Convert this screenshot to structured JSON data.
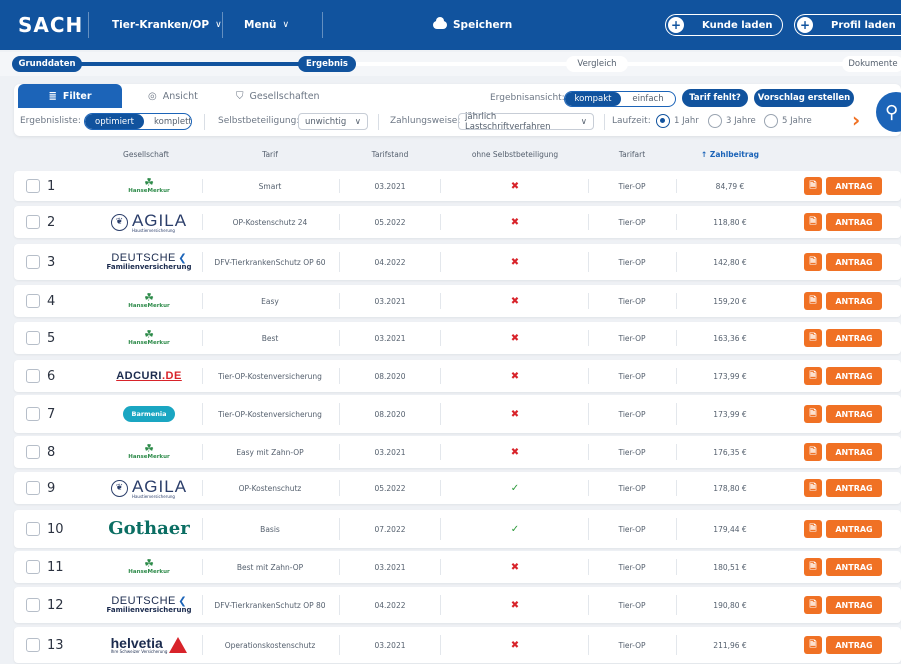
{
  "topbar": {
    "brand": "SACH",
    "product": "Tier-Kranken/OP",
    "menu": "Menü",
    "save": "Speichern",
    "load_customer": "Kunde laden",
    "load_profile": "Profil laden"
  },
  "steps": [
    {
      "label": "Grunddaten",
      "active": true
    },
    {
      "label": "Ergebnis",
      "active": true
    },
    {
      "label": "Vergleich",
      "active": false
    },
    {
      "label": "Dokumente",
      "active": false
    }
  ],
  "filterbar": {
    "tabs": [
      {
        "label": "Filter",
        "icon": "sliders-icon",
        "active": true
      },
      {
        "label": "Ansicht",
        "icon": "eye-icon",
        "active": false
      },
      {
        "label": "Gesellschaften",
        "icon": "shield-check-icon",
        "active": false
      }
    ],
    "view_label": "Ergebnisansicht:",
    "view_options": [
      "kompakt",
      "einfach"
    ],
    "view_selected": "kompakt",
    "tarif_missing": "Tarif fehlt?",
    "suggestion": "Vorschlag erstellen",
    "resultlist_label": "Ergebnisliste:",
    "resultlist_options": [
      "optimiert",
      "komplett"
    ],
    "resultlist_selected": "optimiert",
    "deductible_label": "Selbstbeteiligung:",
    "deductible_value": "unwichtig",
    "payment_label": "Zahlungsweise:",
    "payment_value": "jährlich Lastschriftverfahren",
    "term_label": "Laufzeit:",
    "term_options": [
      "1 Jahr",
      "3 Jahre",
      "5 Jahre"
    ],
    "term_selected": "1 Jahr"
  },
  "table": {
    "headers": {
      "company": "Gesellschaft",
      "tariff": "Tarif",
      "tariff_date": "Tarifstand",
      "no_deductible": "ohne Selbstbeteiligung",
      "tariff_type": "Tarifart",
      "premium": "Zahlbeitrag"
    },
    "sort_column": "premium",
    "action_label": "ANTRAG",
    "rows": [
      {
        "no": "1",
        "logo": "hansemerkur",
        "tariff": "Smart",
        "date": "03.2021",
        "no_deductible": false,
        "type": "Tier-OP",
        "premium": "84,79 €"
      },
      {
        "no": "2",
        "logo": "agila",
        "tariff": "OP-Kostenschutz 24",
        "date": "05.2022",
        "no_deductible": false,
        "type": "Tier-OP",
        "premium": "118,80 €"
      },
      {
        "no": "3",
        "logo": "dfv",
        "tariff": "DFV-TierkrankenSchutz OP 60",
        "date": "04.2022",
        "no_deductible": false,
        "type": "Tier-OP",
        "premium": "142,80 €"
      },
      {
        "no": "4",
        "logo": "hansemerkur",
        "tariff": "Easy",
        "date": "03.2021",
        "no_deductible": false,
        "type": "Tier-OP",
        "premium": "159,20 €"
      },
      {
        "no": "5",
        "logo": "hansemerkur",
        "tariff": "Best",
        "date": "03.2021",
        "no_deductible": false,
        "type": "Tier-OP",
        "premium": "163,36 €"
      },
      {
        "no": "6",
        "logo": "adcuri",
        "tariff": "Tier-OP-Kostenversicherung",
        "date": "08.2020",
        "no_deductible": false,
        "type": "Tier-OP",
        "premium": "173,99 €"
      },
      {
        "no": "7",
        "logo": "barmenia",
        "tariff": "Tier-OP-Kostenversicherung",
        "date": "08.2020",
        "no_deductible": false,
        "type": "Tier-OP",
        "premium": "173,99 €"
      },
      {
        "no": "8",
        "logo": "hansemerkur",
        "tariff": "Easy mit Zahn-OP",
        "date": "03.2021",
        "no_deductible": false,
        "type": "Tier-OP",
        "premium": "176,35 €"
      },
      {
        "no": "9",
        "logo": "agila",
        "tariff": "OP-Kostenschutz",
        "date": "05.2022",
        "no_deductible": true,
        "type": "Tier-OP",
        "premium": "178,80 €"
      },
      {
        "no": "10",
        "logo": "gothaer",
        "tariff": "Basis",
        "date": "07.2022",
        "no_deductible": true,
        "type": "Tier-OP",
        "premium": "179,44 €"
      },
      {
        "no": "11",
        "logo": "hansemerkur",
        "tariff": "Best mit Zahn-OP",
        "date": "03.2021",
        "no_deductible": false,
        "type": "Tier-OP",
        "premium": "180,51 €"
      },
      {
        "no": "12",
        "logo": "dfv",
        "tariff": "DFV-TierkrankenSchutz OP 80",
        "date": "04.2022",
        "no_deductible": false,
        "type": "Tier-OP",
        "premium": "190,80 €"
      },
      {
        "no": "13",
        "logo": "helvetia",
        "tariff": "Operationskostenschutz",
        "date": "03.2021",
        "no_deductible": false,
        "type": "Tier-OP",
        "premium": "211,96 €"
      }
    ]
  },
  "logos": {
    "hansemerkur": {
      "text": "HanseMerkur"
    },
    "agila": {
      "text": "AGILA",
      "sub": "Haustierversicherung"
    },
    "dfv": {
      "text": "DEUTSCHE",
      "sub": "Familienversicherung"
    },
    "adcuri": {
      "text": "ADCURI",
      "suffix": ".DE"
    },
    "barmenia": {
      "text": "Barmenia"
    },
    "gothaer": {
      "text": "Gothaer"
    },
    "helvetia": {
      "text": "helvetia",
      "sub": "Ihre Schweizer Versicherung"
    }
  },
  "colors": {
    "primary": "#11539e",
    "accent": "#f07124",
    "cross": "#d8232a",
    "check": "#2d9a3b"
  }
}
